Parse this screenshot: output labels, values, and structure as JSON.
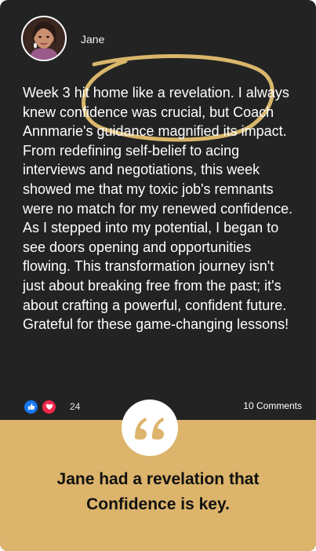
{
  "post": {
    "author": "Jane",
    "avatar_icon": "profile-photo",
    "text": "Week 3 hit home like a revelation. I always knew confidence was crucial, but Coach Annmarie's guidance magnified its impact. From redefining self-belief to acing interviews and negotiations, this week showed me that my toxic job's remnants were no match for my renewed confidence. As I stepped into my potential, I began to see doors opening and opportunities flowing. This transformation journey isn't just about breaking free from the past; it's about crafting a powerful, confident future. Grateful for these game-changing lessons!",
    "reaction_count": "24",
    "comments_label": "10 Comments",
    "reaction_icons": [
      "like-icon",
      "love-icon"
    ]
  },
  "caption": {
    "line1": "Jane had a revelation that",
    "line2": "Confidence is key."
  },
  "colors": {
    "card_background": "#232323",
    "accent_gold": "#dcb46b",
    "like_blue": "#1877f2",
    "love_red": "#f0284a"
  }
}
